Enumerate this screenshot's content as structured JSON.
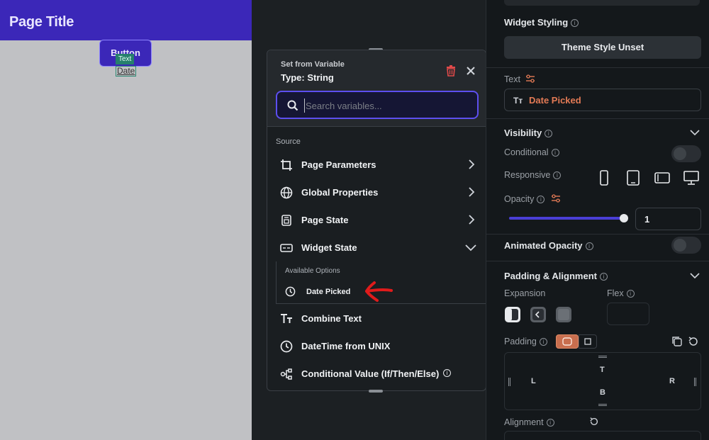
{
  "canvas": {
    "page_title": "Page Title",
    "button_label": "Button",
    "text_tag": "Text",
    "date_text": "Date"
  },
  "popup": {
    "subtitle": "Set from Variable",
    "type_label": "Type: String",
    "search_placeholder": "Search variables...",
    "source_label": "Source",
    "sources": [
      {
        "label": "Page Parameters",
        "icon": "page-parameters-icon"
      },
      {
        "label": "Global Properties",
        "icon": "globe-icon"
      },
      {
        "label": "Page State",
        "icon": "page-state-icon"
      },
      {
        "label": "Widget State",
        "icon": "widget-state-icon"
      },
      {
        "label": "Combine Text",
        "icon": "text-icon"
      },
      {
        "label": "DateTime from UNIX",
        "icon": "clock-icon"
      },
      {
        "label": "Conditional Value (If/Then/Else)",
        "icon": "conditional-icon"
      }
    ],
    "available_options_label": "Available Options",
    "available_option": "Date Picked"
  },
  "panel": {
    "widget_styling": "Widget Styling",
    "theme_style": "Theme Style Unset",
    "text_label": "Text",
    "text_value": "Date Picked",
    "visibility": "Visibility",
    "conditional": "Conditional",
    "responsive": "Responsive",
    "opacity": "Opacity",
    "opacity_value": "1",
    "opacity_level": 1.0,
    "animated_opacity": "Animated Opacity",
    "padding_alignment": "Padding & Alignment",
    "expansion": "Expansion",
    "flex": "Flex",
    "padding": "Padding",
    "pad_top": "T",
    "pad_bottom": "B",
    "pad_left": "L",
    "pad_right": "R",
    "alignment": "Alignment"
  },
  "colors": {
    "brand": "#3b27b8",
    "accent": "#5d4ff0",
    "variable_text": "#e37a55",
    "annotation_arrow": "#e01b1b"
  }
}
